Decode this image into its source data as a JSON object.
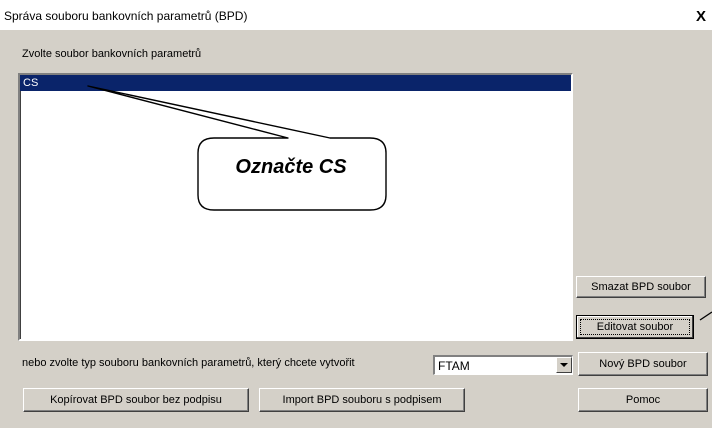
{
  "window": {
    "title": "Správa souboru bankovních parametrů (BPD)",
    "close_label": "X"
  },
  "main": {
    "prompt_label": "Zvolte soubor bankovních parametrů",
    "files": [
      {
        "label": "CS",
        "selected": true
      }
    ],
    "type_prompt": "nebo zvolte typ souboru bankovních parametrů, který chcete vytvořit",
    "type_select_value": "FTAM"
  },
  "callout": {
    "text": "Označte CS"
  },
  "buttons": {
    "delete_label": "Smazat BPD soubor",
    "edit_label": "Editovat soubor",
    "new_label": "Nový BPD soubor",
    "copy_label": "Kopírovat BPD soubor bez podpisu",
    "import_label": "Import BPD souboru s podpisem",
    "help_label": "Pomoc"
  },
  "colors": {
    "selection": "#0a246a",
    "dialog_face": "#d4d0c8"
  }
}
